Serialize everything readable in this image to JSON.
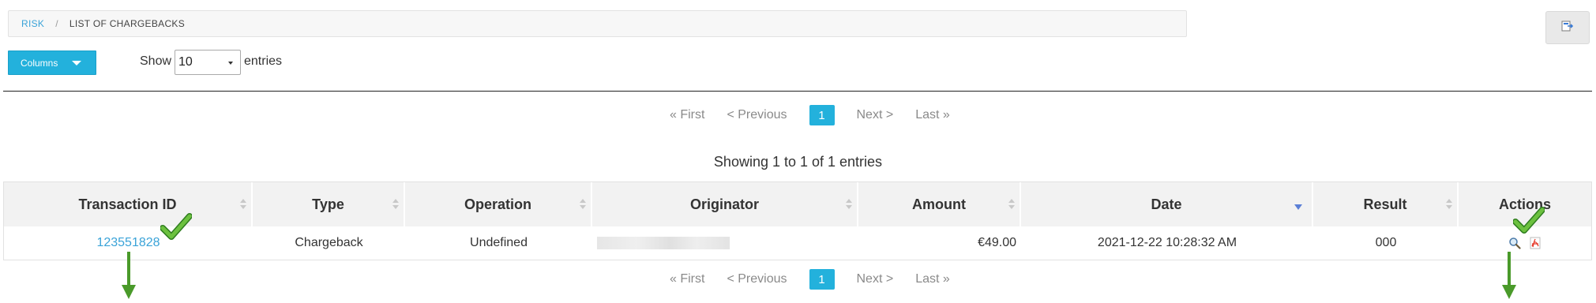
{
  "breadcrumb": {
    "root": "RISK",
    "separator": "/",
    "current": "LIST OF CHARGEBACKS"
  },
  "toolbar": {
    "columns_label": "Columns",
    "show_label": "Show",
    "page_size": "10",
    "entries_label": "entries"
  },
  "pagination": {
    "first": "« First",
    "previous": "< Previous",
    "current_page": "1",
    "next": "Next >",
    "last": "Last »"
  },
  "summary": "Showing 1 to 1 of 1 entries",
  "table": {
    "headers": [
      "Transaction ID",
      "Type",
      "Operation",
      "Originator",
      "Amount",
      "Date",
      "Result",
      "Actions"
    ],
    "sorted_column": "Date",
    "rows": [
      {
        "transaction_id": "123551828",
        "type": "Chargeback",
        "operation": "Undefined",
        "originator": "",
        "amount": "€49.00",
        "date": "2021-12-22 10:28:32 AM",
        "result": "000"
      }
    ]
  },
  "colors": {
    "accent": "#23b1dc",
    "link": "#3aa3d8",
    "annotation_green": "#4a9a2a"
  },
  "icons": [
    "export-icon",
    "caret-down-icon",
    "search-icon",
    "pdf-icon",
    "checkmark-icon",
    "arrow-down-icon"
  ]
}
